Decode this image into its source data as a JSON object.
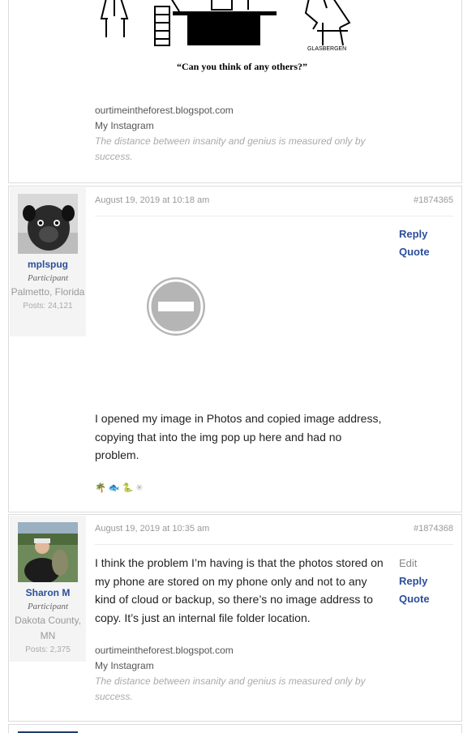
{
  "top_post": {
    "cartoon_caption": "“Can you think of any others?”",
    "cartoon_signature": "GLASBERGEN",
    "signature_link_1": "ourtimeintheforest.blogspot.com",
    "signature_link_2": "My Instagram",
    "signature_quote": "The distance between insanity and genius is measured only by success."
  },
  "replies": [
    {
      "author": {
        "name": "mplspug",
        "role": "Participant",
        "location": "Palmetto, Florida",
        "posts": "Posts: 24,121"
      },
      "date": "August 19, 2019 at 10:18 am",
      "id": "#1874365",
      "actions": {
        "reply": "Reply",
        "quote": "Quote"
      },
      "text": "I opened my image in Photos and copied image address, copying that into the img pop up here and had no problem.",
      "emoji_icons": [
        "palm-tree-icon",
        "fish-icon",
        "snake-icon",
        "sparkle-icon"
      ]
    },
    {
      "author": {
        "name": "Sharon M",
        "role": "Participant",
        "location": "Dakota County, MN",
        "posts": "Posts: 2,375"
      },
      "date": "August 19, 2019 at 10:35 am",
      "id": "#1874368",
      "actions": {
        "edit": "Edit",
        "reply": "Reply",
        "quote": "Quote"
      },
      "text": "I think the problem I’m having is that the photos stored on my phone are stored on my phone only and not to any kind of cloud or backup, so there’s no image address to copy. It’s just an internal file folder location.",
      "signature_link_1": "ourtimeintheforest.blogspot.com",
      "signature_link_2": "My Instagram",
      "signature_quote": "The distance between insanity and genius is measured only by success."
    }
  ],
  "colors": {
    "link": "#2b4f9a",
    "meta": "#999999",
    "border": "#dcdcdc",
    "author_bg": "#f4f4f4"
  }
}
